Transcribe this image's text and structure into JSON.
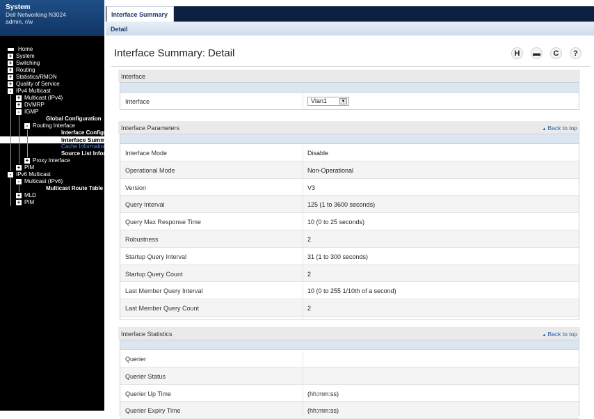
{
  "system": {
    "title": "System",
    "device": "Dell Networking N3024",
    "user": "admin, r/w"
  },
  "nav": {
    "items": [
      {
        "label": "Home",
        "indent": 0,
        "icon": "home-icon"
      },
      {
        "label": "System",
        "indent": 0,
        "expander": "+"
      },
      {
        "label": "Switching",
        "indent": 0,
        "expander": "+"
      },
      {
        "label": "Routing",
        "indent": 0,
        "expander": "+"
      },
      {
        "label": "Statistics/RMON",
        "indent": 0,
        "expander": "+"
      },
      {
        "label": "Quality of Service",
        "indent": 0,
        "expander": "+"
      },
      {
        "label": "IPv4 Multicast",
        "indent": 0,
        "expander": "-"
      },
      {
        "label": "Multicast (IPv4)",
        "indent": 1,
        "expander": "+"
      },
      {
        "label": "DVMRP",
        "indent": 1,
        "expander": "+"
      },
      {
        "label": "IGMP",
        "indent": 1,
        "expander": "-"
      },
      {
        "label": "Global Configuration",
        "indent": 2,
        "bold": true
      },
      {
        "label": "Routing Interface",
        "indent": 2,
        "expander": "-"
      },
      {
        "label": "Interface Configuration",
        "indent": 3,
        "bold": true
      },
      {
        "label": "Interface Summary",
        "indent": 3,
        "selected": true
      },
      {
        "label": "Cache Information",
        "indent": 3,
        "link": true
      },
      {
        "label": "Source List Information",
        "indent": 3,
        "bold": true
      },
      {
        "label": "Proxy Interface",
        "indent": 2,
        "expander": "+"
      },
      {
        "label": "PIM",
        "indent": 1,
        "expander": "+"
      },
      {
        "label": "IPv6 Multicast",
        "indent": 0,
        "expander": "-"
      },
      {
        "label": "Multicast (IPv6)",
        "indent": 1,
        "expander": "-"
      },
      {
        "label": "Multicast Route Table",
        "indent": 2,
        "bold": true
      },
      {
        "label": "MLD",
        "indent": 1,
        "expander": "+"
      },
      {
        "label": "PIM",
        "indent": 1,
        "expander": "+"
      }
    ]
  },
  "tabs": {
    "active": "Interface Summary",
    "sub": "Detail"
  },
  "page": {
    "title": "Interface Summary: Detail",
    "tools": [
      {
        "name": "help-save-icon",
        "glyph": "H"
      },
      {
        "name": "print-icon",
        "glyph": "▬"
      },
      {
        "name": "refresh-icon",
        "glyph": "C"
      },
      {
        "name": "help-icon",
        "glyph": "?"
      }
    ]
  },
  "sections": {
    "interface": {
      "title": "Interface",
      "field_label": "Interface",
      "selected": "Vlan1",
      "dropdown_glyph": "▼"
    },
    "parameters": {
      "title": "Interface Parameters",
      "back_to_top": "Back to top",
      "rows": [
        {
          "label": "Interface Mode",
          "value": "Disable"
        },
        {
          "label": "Operational Mode",
          "value": "Non-Operational"
        },
        {
          "label": "Version",
          "value": "V3"
        },
        {
          "label": "Query Interval",
          "value": "125  (1 to 3600 seconds)"
        },
        {
          "label": "Query Max Response Time",
          "value": "10  (0 to 25 seconds)"
        },
        {
          "label": "Robustness",
          "value": "2"
        },
        {
          "label": "Startup Query Interval",
          "value": "31  (1 to 300 seconds)"
        },
        {
          "label": "Startup Query Count",
          "value": "2"
        },
        {
          "label": "Last Member Query Interval",
          "value": "10  (0 to 255 1/10th of a second)"
        },
        {
          "label": "Last Member Query Count",
          "value": "2"
        }
      ]
    },
    "statistics": {
      "title": "Interface Statistics",
      "back_to_top": "Back to top",
      "rows": [
        {
          "label": "Querier",
          "value": ""
        },
        {
          "label": "Querier Status",
          "value": ""
        },
        {
          "label": "Querier Up Time",
          "value": "(hh:mm:ss)"
        },
        {
          "label": "Querier Expiry Time",
          "value": "(hh:mm:ss)"
        }
      ]
    }
  }
}
